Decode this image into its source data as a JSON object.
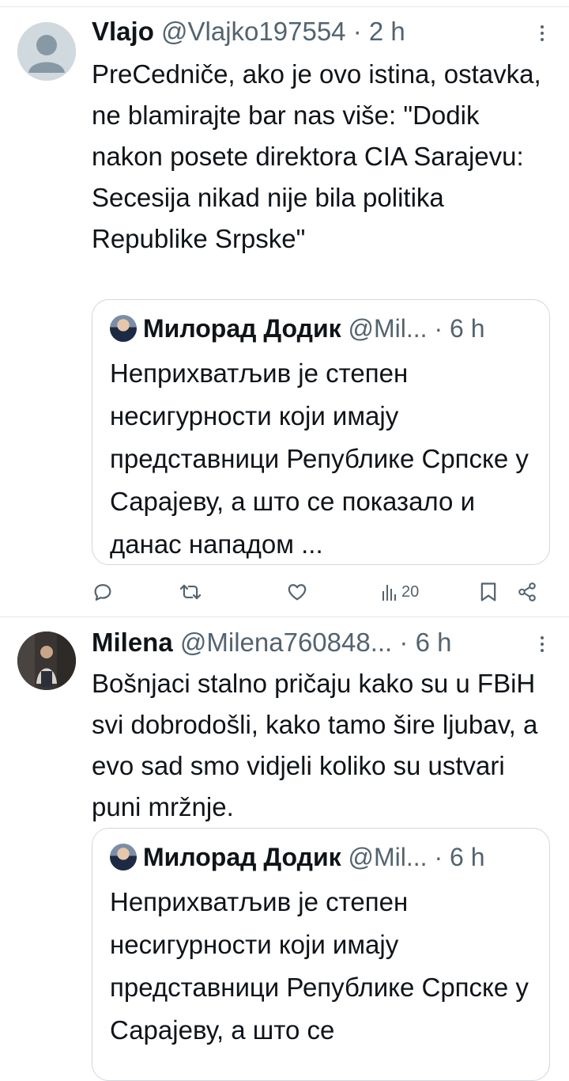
{
  "tweets": [
    {
      "name": "Vlajo",
      "handle": "@Vlajko197554",
      "separator": "·",
      "time": "2 h",
      "text": "PreCedniče, ako je ovo istina, ostavka, ne blamirajte bar nas više: \"Dodik nakon posete direktora CIA Sarajevu: Secesija nikad nije bila politika Republike Srpske\"",
      "quote": {
        "name": "Милорад Додик",
        "handle": "@Mil...",
        "separator": "·",
        "time": "6 h",
        "text": "Неприхватљив је степен несигурности који имају представници Републике Српске у Сарајеву, а што се показало и данас нападом ..."
      },
      "actions": {
        "views": "20"
      }
    },
    {
      "name": "Milena",
      "handle": "@Milena760848...",
      "separator": "·",
      "time": "6 h",
      "text": "Bošnjaci stalno pričaju kako su u FBiH svi dobrodošli, kako tamo šire ljubav, a evo sad smo vidjeli koliko su ustvari puni mržnje.",
      "quote": {
        "name": "Милорад Додик",
        "handle": "@Mil...",
        "separator": "·",
        "time": "6 h",
        "text": "Неприхватљив је степен несигурности који имају представници Републике Српске у Сарајеву, а што се"
      }
    }
  ],
  "colors": {
    "text": "#0f1419",
    "secondary": "#536471",
    "border": "#cfd9de"
  },
  "icons": [
    "more-icon",
    "reply-icon",
    "retweet-icon",
    "like-icon",
    "views-icon",
    "bookmark-icon",
    "share-icon"
  ]
}
